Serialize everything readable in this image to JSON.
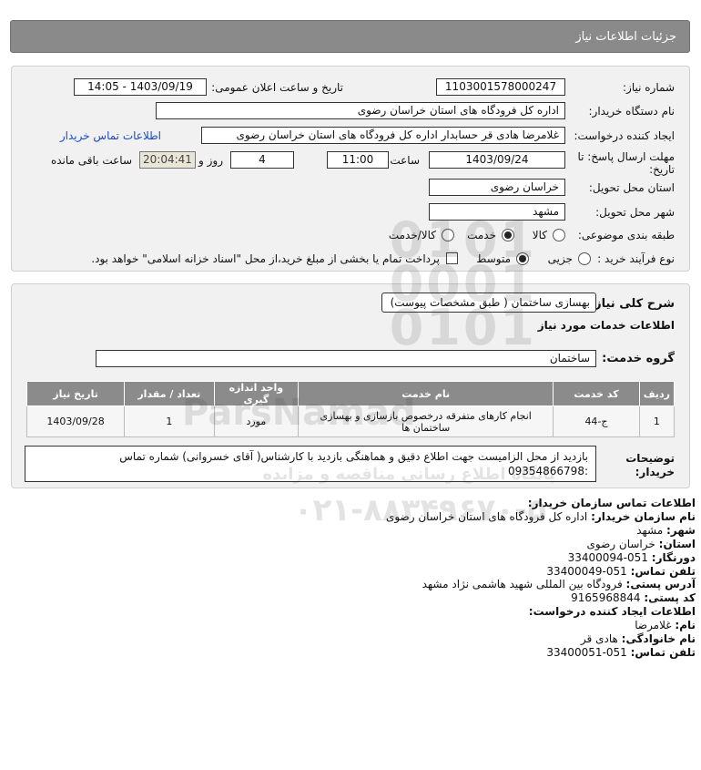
{
  "header": {
    "title": "جزئیات اطلاعات نیاز"
  },
  "info": {
    "need_number_label": "شماره نیاز:",
    "need_number": "1103001578000247",
    "announce_label": "تاریخ و ساعت اعلان عمومی:",
    "announce_value": "1403/09/19 - 14:05",
    "buyer_org_label": "نام دستگاه خریدار:",
    "buyer_org": "اداره کل فرودگاه های استان خراسان رضوی",
    "creator_label": "ایجاد کننده درخواست:",
    "creator": "غلامرضا هادی قر حسابدار اداره کل فرودگاه های استان خراسان رضوی",
    "buyer_contact_link": "اطلاعات تماس خریدار",
    "deadline_label_line1": "مهلت ارسال پاسخ: تا",
    "deadline_label_line2": "تاریخ:",
    "deadline_date": "1403/09/24",
    "time_label": "ساعت",
    "deadline_time": "11:00",
    "days_value": "4",
    "days_label": "روز و",
    "remaining_time": "20:04:41",
    "remaining_label": "ساعت باقی مانده",
    "province_label": "استان محل تحویل:",
    "province": "خراسان رضوی",
    "city_label": "شهر محل تحویل:",
    "city": "مشهد",
    "category_label": "طبقه بندی موضوعی:",
    "category_options": [
      "کالا",
      "خدمت",
      "کالا/خدمت"
    ],
    "category_selected": "خدمت",
    "process_label": "نوع فرآیند خرید :",
    "process_options": [
      "جزیی",
      "متوسط"
    ],
    "process_selected": "متوسط",
    "payment_note": "پرداخت تمام یا بخشی از مبلغ خرید،از محل \"اسناد خزانه اسلامی\" خواهد بود."
  },
  "description": {
    "label": "شرح کلی نیاز:",
    "value": "بهسازی ساختمان ( طبق مشخصات پیوست)",
    "services_title": "اطلاعات خدمات مورد نیاز",
    "service_group_label": "گروه خدمت:",
    "service_group": "ساختمان"
  },
  "table": {
    "headers": [
      "ردیف",
      "کد خدمت",
      "نام خدمت",
      "واحد اندازه گیری",
      "تعداد / مقدار",
      "تاریخ نیاز"
    ],
    "rows": [
      [
        "1",
        "ج-44",
        "انجام کارهای متفرقه درخصوص بازسازی و بهسازی ساختمان ها",
        "مورد",
        "1",
        "1403/09/28"
      ]
    ]
  },
  "buyer_notes": {
    "label_line1": "توضیحات",
    "label_line2": "خریدار:",
    "text_line1": "بازدید از محل الزامیست جهت اطلاع دقیق و هماهنگی بازدید با کارشناس( آقای خسروانی) شماره تماس",
    "text_line2": ":09354866798"
  },
  "watermark": {
    "numbers": "0101 0001 0101",
    "brand": "ParsNamad",
    "tagline": "پایگاه اطلاع رسانی مناقصه و مزایده",
    "phone": "۰۲۱-۸۸۳۴۹۶۷۰-۵"
  },
  "contact": {
    "org_title": "اطلاعات تماس سازمان خریدار:",
    "buyer_name_label": "نام سازمان خریدار:",
    "buyer_name": "اداره کل فرودگاه های استان خراسان رضوی",
    "city_label": "شهر:",
    "city": "مشهد",
    "province_label": "استان:",
    "province": "خراسان رضوی",
    "fax_label": "دورنگار:",
    "fax": "051-33400094",
    "phone_label": "تلفن تماس:",
    "phone": "051-33400049",
    "address_label": "آدرس پستی:",
    "address": "فرودگاه بین المللی شهید هاشمی نژاد مشهد",
    "postal_label": "کد پستی:",
    "postal": "9165968844",
    "creator_title": "اطلاعات ایجاد کننده درخواست:",
    "first_name_label": "نام:",
    "first_name": "غلامرضا",
    "last_name_label": "نام خانوادگی:",
    "last_name": "هادی قر",
    "creator_phone_label": "تلفن تماس:",
    "creator_phone": "051-33400051"
  }
}
